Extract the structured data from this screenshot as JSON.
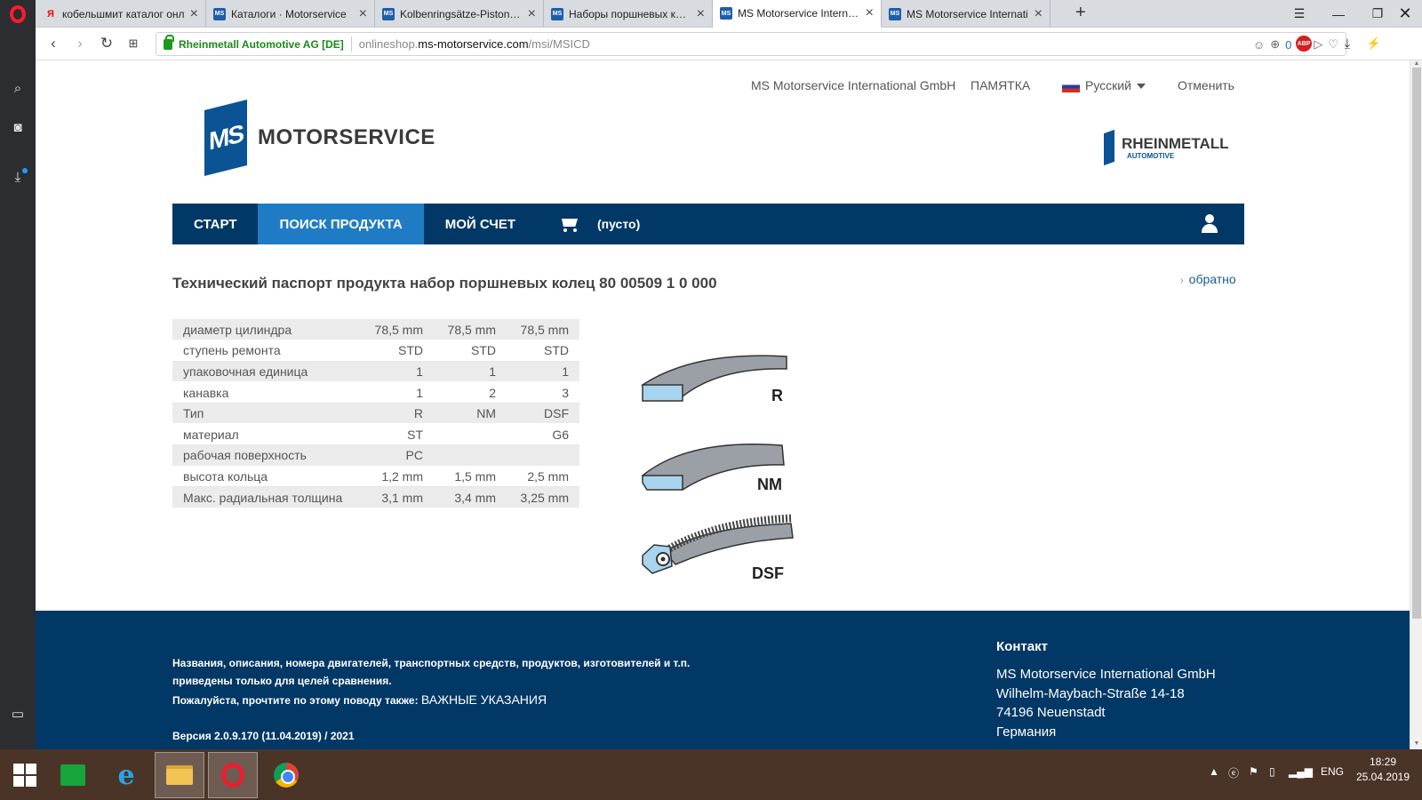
{
  "tabs": [
    {
      "title": "кобельшмит каталог онл",
      "favicon": "yandex"
    },
    {
      "title": "Каталоги · Motorservice",
      "favicon": "ms"
    },
    {
      "title": "Kolbenringsätze-Piston-rir",
      "favicon": "ms"
    },
    {
      "title": "Наборы поршневых коле",
      "favicon": "ms"
    },
    {
      "title": "MS Motorservice Internatic",
      "favicon": "ms",
      "active": true
    },
    {
      "title": "MS Motorservice Internati",
      "favicon": "ms"
    }
  ],
  "address": {
    "org": "Rheinmetall Automotive AG [DE]",
    "url_prefix": "onlineshop.",
    "url_host": "ms-motorservice.com",
    "url_path": "/msi/MSICD",
    "counter": "0"
  },
  "topnav": {
    "company": "MS Motorservice International GmbH",
    "memo": "ПАМЯТКА",
    "language": "Русский",
    "cancel": "Отменить"
  },
  "logos": {
    "ms_mark": "MS",
    "ms_text": "MOTORSERVICE",
    "rh_big": "RHEINMETALL",
    "rh_small": "AUTOMOTIVE"
  },
  "mainnav": {
    "start": "СТАРТ",
    "product_search": "ПОИСК ПРОДУКТА",
    "my_account": "МОЙ СЧЕТ",
    "cart": "(пусто)"
  },
  "page": {
    "title": "Технический паспорт продукта набор поршневых колец 80 00509 1 0 000",
    "back": "обратно"
  },
  "spec_rows": [
    {
      "label": "диаметр цилиндра",
      "values": [
        "78,5 mm",
        "78,5 mm",
        "78,5 mm"
      ]
    },
    {
      "label": "ступень ремонта",
      "values": [
        "STD",
        "STD",
        "STD"
      ]
    },
    {
      "label": "упаковочная единица",
      "values": [
        "1",
        "1",
        "1"
      ]
    },
    {
      "label": "канавка",
      "values": [
        "1",
        "2",
        "3"
      ]
    },
    {
      "label": "Тип",
      "values": [
        "R",
        "NM",
        "DSF"
      ]
    },
    {
      "label": "материал",
      "values": [
        "ST",
        "",
        "G6"
      ]
    },
    {
      "label": "рабочая поверхность",
      "values": [
        "PC",
        "",
        ""
      ]
    },
    {
      "label": "высота кольца",
      "values": [
        "1,2 mm",
        "1,5 mm",
        "2,5 mm"
      ]
    },
    {
      "label": "Макс. радиальная толщина",
      "values": [
        "3,1 mm",
        "3,4 mm",
        "3,25 mm"
      ]
    }
  ],
  "rings": {
    "r": "R",
    "nm": "NM",
    "dsf": "DSF"
  },
  "footer": {
    "line1": "Названия, описания, номера двигателей, транспортных средств, продуктов, изготовителей и т.п.",
    "line2": "приведены только для целей сравнения.",
    "line3": "Пожалуйста, прочтите по этому поводу также:",
    "notice_link": "ВАЖНЫЕ УКАЗАНИЯ",
    "version": "Версия 2.0.9.170 (11.04.2019) / 2021",
    "contact_heading": "Контакт",
    "contact_lines": [
      "MS Motorservice International GmbH",
      "Wilhelm-Maybach-Straße 14-18",
      "74196 Neuenstadt",
      "Германия"
    ]
  },
  "taskbar": {
    "lang": "ENG",
    "time": "18:29",
    "date": "25.04.2019"
  },
  "colors": {
    "nav_bg": "#023865",
    "nav_active": "#1f7cc4",
    "footer_bg": "#023865",
    "brand_blue": "#0b5394"
  }
}
